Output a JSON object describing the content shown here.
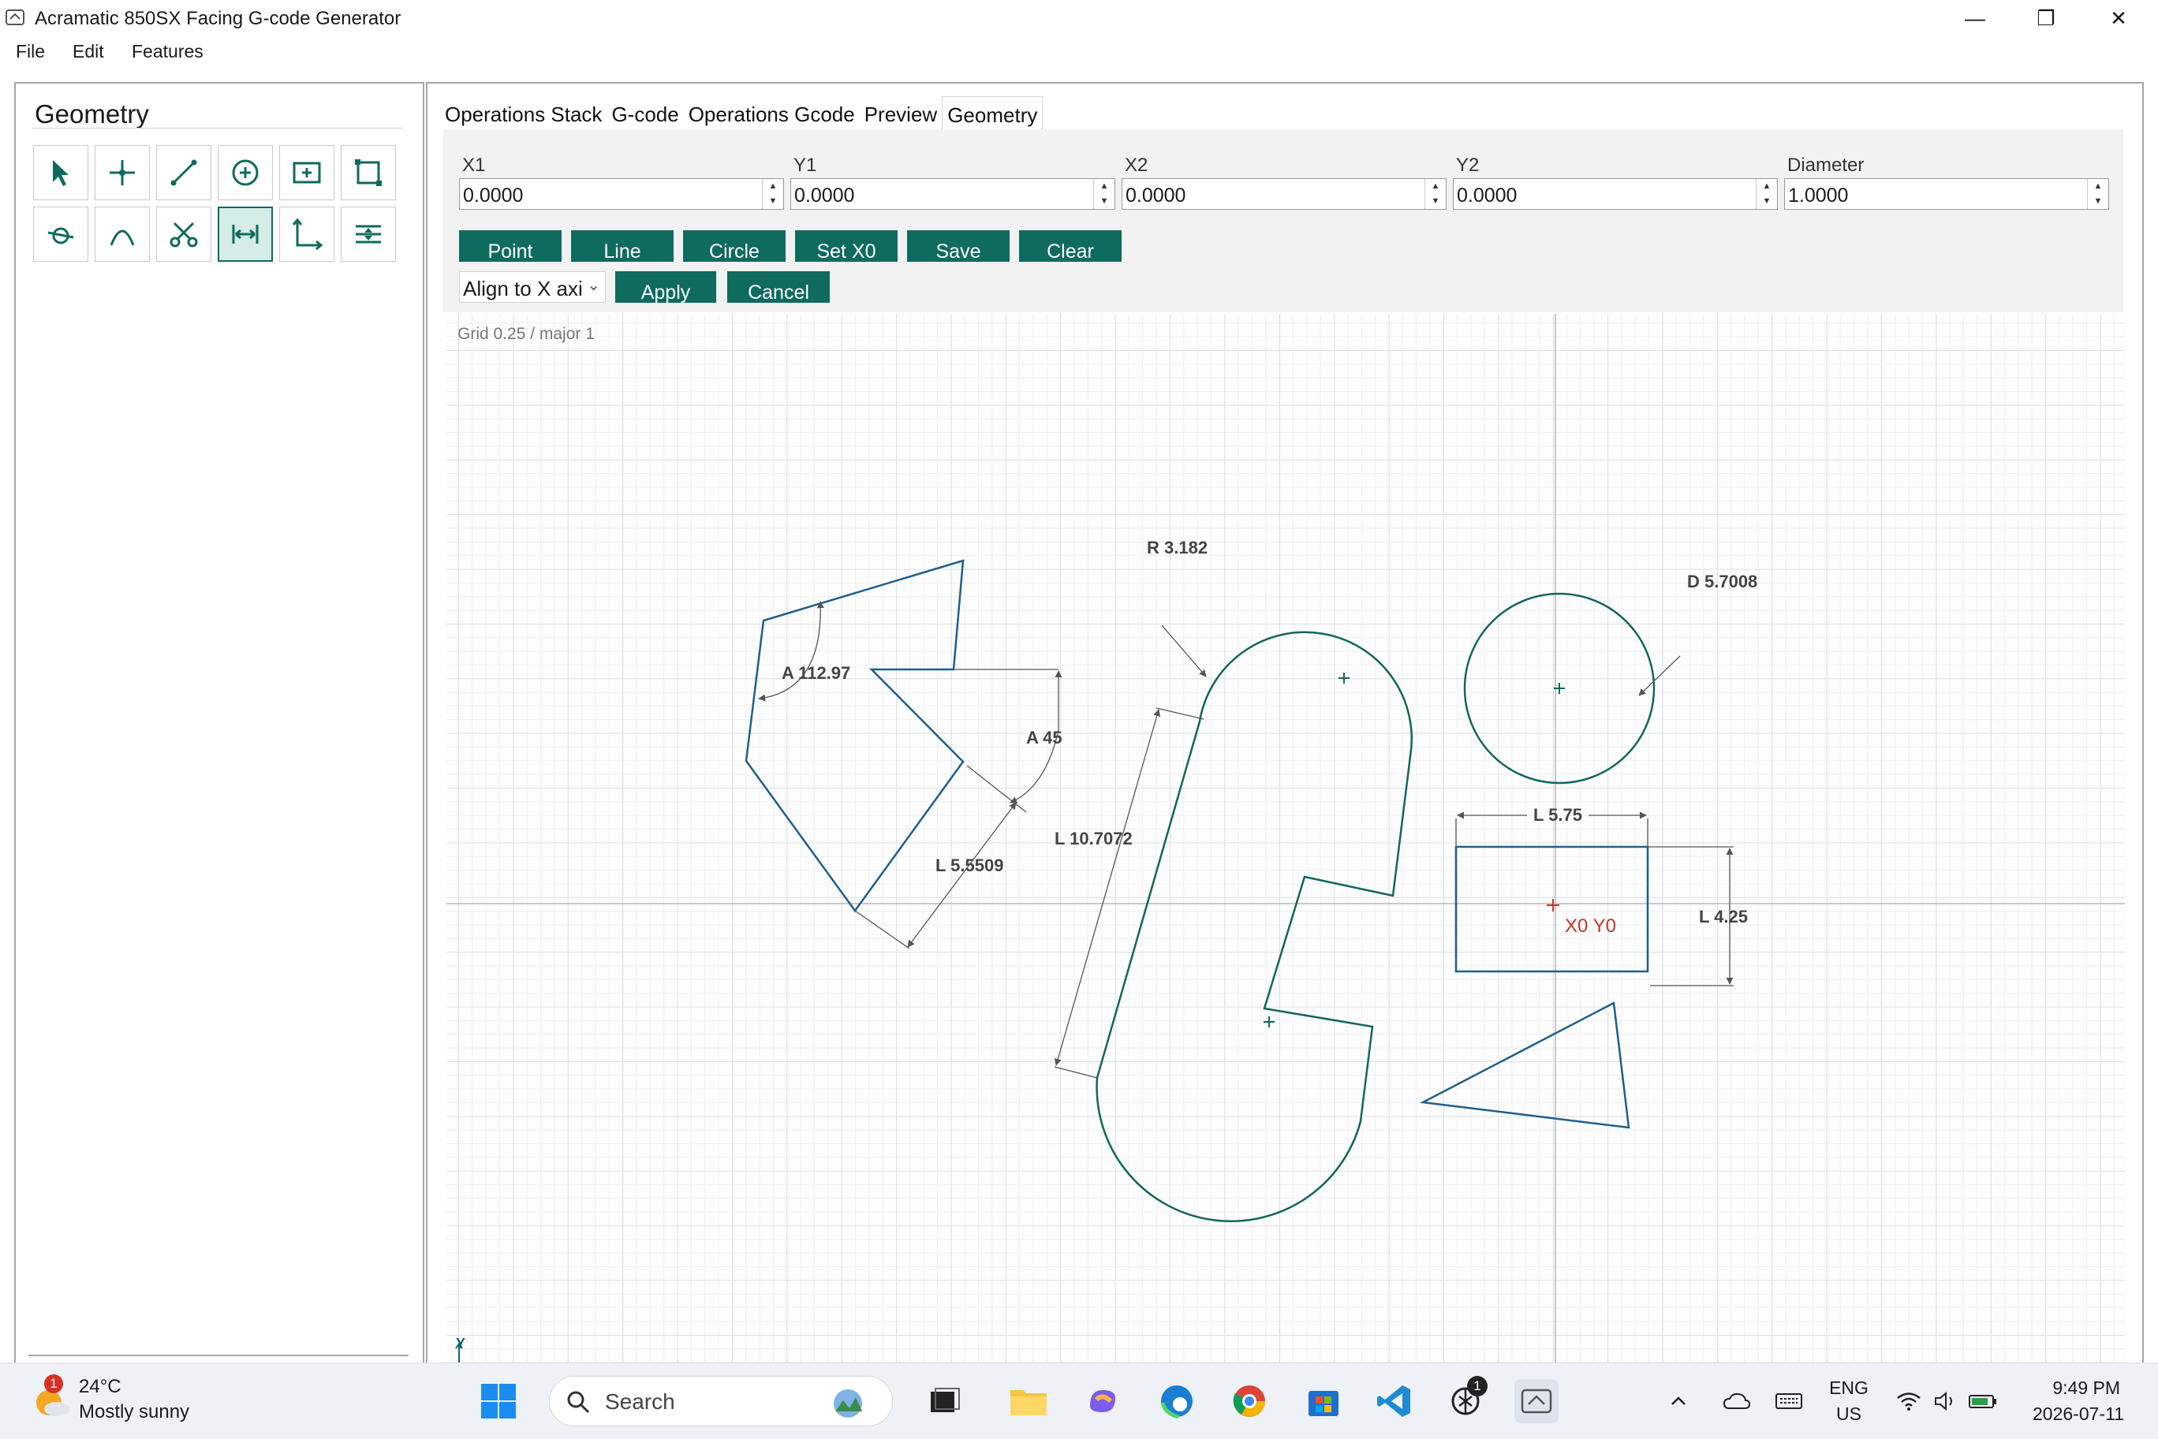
{
  "window": {
    "title": "Acramatic 850SX Facing G-code Generator",
    "minimize": "—",
    "maximize": "❐",
    "close": "✕"
  },
  "menu": [
    "File",
    "Edit",
    "Features"
  ],
  "left_panel": {
    "title": "Geometry",
    "tools": [
      {
        "icon": "select-arrow-icon"
      },
      {
        "icon": "point-icon"
      },
      {
        "icon": "line-icon"
      },
      {
        "icon": "circle-icon"
      },
      {
        "icon": "rectangle-icon"
      },
      {
        "icon": "square-icon"
      },
      {
        "icon": "tangent-icon"
      },
      {
        "icon": "arc-icon"
      },
      {
        "icon": "scissors-icon"
      },
      {
        "icon": "dimension-icon"
      },
      {
        "icon": "axis-icon"
      },
      {
        "icon": "align-icon"
      }
    ]
  },
  "tabs": [
    "Operations Stack",
    "G-code",
    "Operations Gcode",
    "Preview",
    "Geometry"
  ],
  "fields": [
    {
      "label": "X1",
      "value": "0.0000"
    },
    {
      "label": "Y1",
      "value": "0.0000"
    },
    {
      "label": "X2",
      "value": "0.0000"
    },
    {
      "label": "Y2",
      "value": "0.0000"
    },
    {
      "label": "Diameter",
      "value": "1.0000"
    }
  ],
  "buttons": [
    "Point",
    "Line",
    "Circle",
    "Set X0",
    "Save",
    "Clear"
  ],
  "align": {
    "value": "Align to X axis",
    "apply": "Apply",
    "cancel": "Cancel"
  },
  "canvas": {
    "grid_info": "Grid 0.25 / major 1",
    "labels": {
      "radius": "R 3.182",
      "diameter": "D 5.7008",
      "angle1": "A 112.97",
      "angle2": "A 45",
      "length1": "L 5.5509",
      "length2": "L 10.7072",
      "length3": "L 5.75",
      "length4": "L 4.25",
      "origin": "X0 Y0",
      "y_axis": "Y"
    }
  },
  "colors": {
    "accent": "#0e6b5e",
    "shape_line": "#1f5f8b",
    "origin": "#c0392b"
  },
  "taskbar": {
    "weather_temp": "24°C",
    "weather_desc": "Mostly sunny",
    "weather_badge": "1",
    "search": "Search",
    "chat_badge": "1",
    "lang1": "ENG",
    "lang2": "US",
    "time": "9:49 PM",
    "date": "2026-07-11"
  }
}
